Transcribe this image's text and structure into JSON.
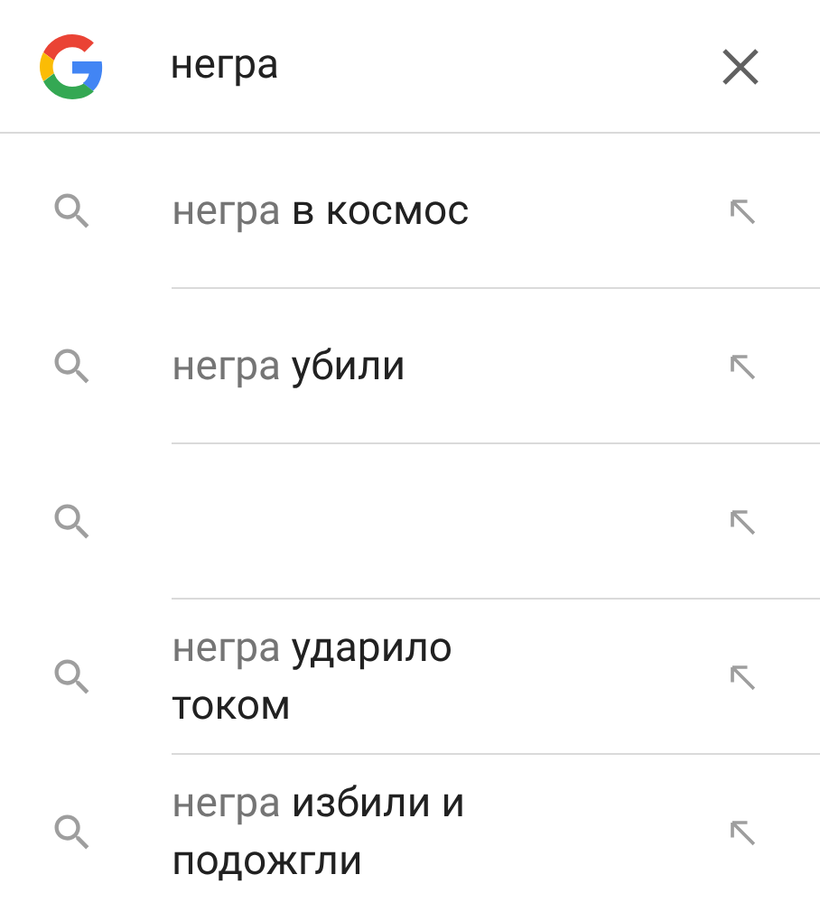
{
  "search": {
    "value": "негра"
  },
  "suggestions": [
    {
      "kind": "text",
      "typed": "негра",
      "completion": "в космос"
    },
    {
      "kind": "text",
      "typed": "негра",
      "completion": "убили"
    },
    {
      "kind": "blank"
    },
    {
      "kind": "text",
      "typed": "негра",
      "completion": "ударило током"
    },
    {
      "kind": "text",
      "typed": "негра",
      "completion": "избили и подожгли"
    }
  ]
}
